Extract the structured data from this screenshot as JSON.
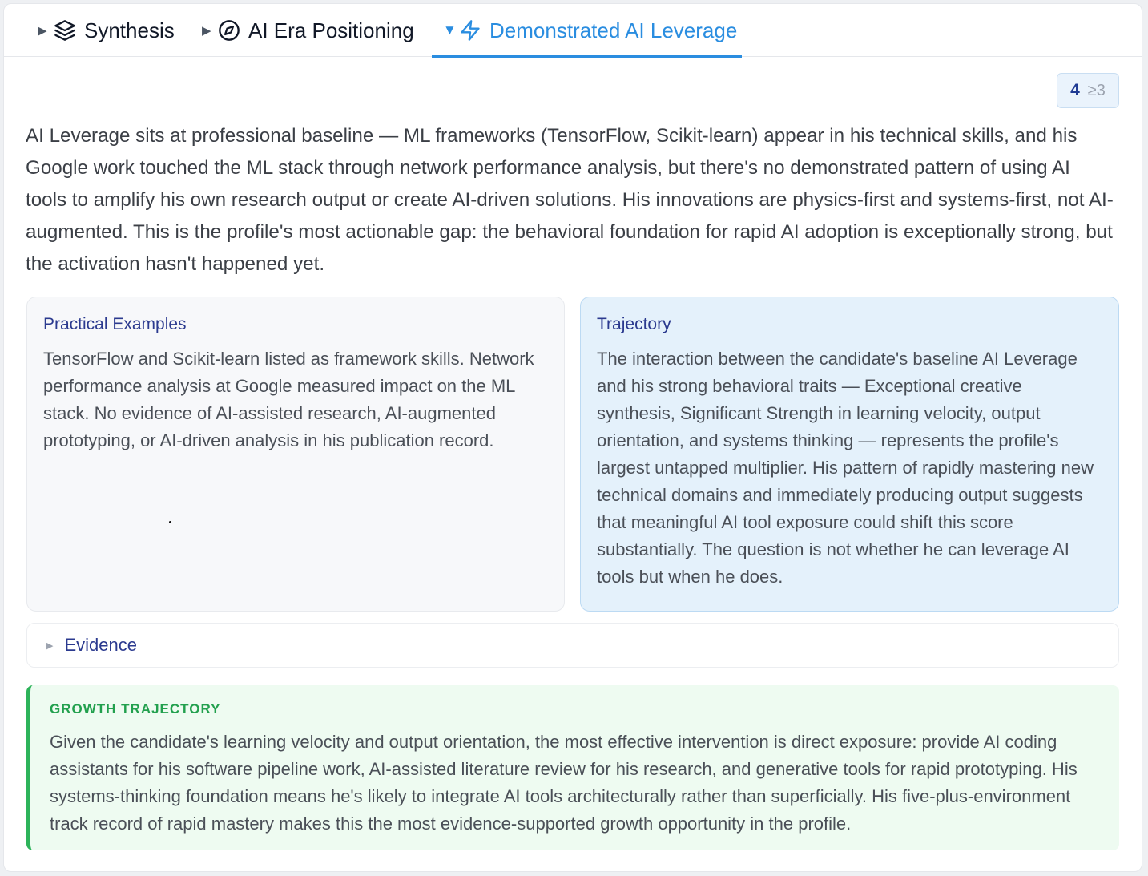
{
  "tabs": [
    {
      "caret": "▶",
      "icon": "layers-icon",
      "label": "Synthesis",
      "active": false
    },
    {
      "caret": "▶",
      "icon": "compass-icon",
      "label": "AI Era Positioning",
      "active": false
    },
    {
      "caret": "▼",
      "icon": "lightning-icon",
      "label": "Demonstrated AI Leverage",
      "active": true
    }
  ],
  "score": {
    "value": "4",
    "threshold": "≥3"
  },
  "summary": "AI Leverage sits at professional baseline — ML frameworks (TensorFlow, Scikit-learn) appear in his technical skills, and his Google work touched the ML stack through network performance analysis, but there's no demonstrated pattern of using AI tools to amplify his own research output or create AI-driven solutions. His innovations are physics-first and systems-first, not AI-augmented. This is the profile's most actionable gap: the behavioral foundation for rapid AI adoption is exceptionally strong, but the activation hasn't happened yet.",
  "practical_examples": {
    "title": "Practical Examples",
    "body": "TensorFlow and Scikit-learn listed as framework skills. Network performance analysis at Google measured impact on the ML stack. No evidence of AI-assisted research, AI-augmented prototyping, or AI-driven analysis in his publication record."
  },
  "trajectory": {
    "title": "Trajectory",
    "body": "The interaction between the candidate's baseline AI Leverage and his strong behavioral traits — Exceptional creative synthesis, Significant Strength in learning velocity, output orientation, and systems thinking — represents the profile's largest untapped multiplier. His pattern of rapidly mastering new technical domains and immediately producing output suggests that meaningful AI tool exposure could shift this score substantially. The question is not whether he can leverage AI tools but when he does."
  },
  "evidence": {
    "caret": "▶",
    "label": "Evidence"
  },
  "growth": {
    "title": "GROWTH TRAJECTORY",
    "body": "Given the candidate's learning velocity and output orientation, the most effective intervention is direct exposure: provide AI coding assistants for his software pipeline work, AI-assisted literature review for his research, and generative tools for rapid prototyping. His systems-thinking foundation means he's likely to integrate AI tools architecturally rather than superficially. His five-plus-environment track record of rapid mastery makes this the most evidence-supported growth opportunity in the profile."
  },
  "colors": {
    "accent": "#2a8de0",
    "title_navy": "#2b3a8f",
    "growth_green": "#2db35a",
    "trajectory_bg": "#e4f1fb",
    "growth_bg": "#eefbf1"
  }
}
